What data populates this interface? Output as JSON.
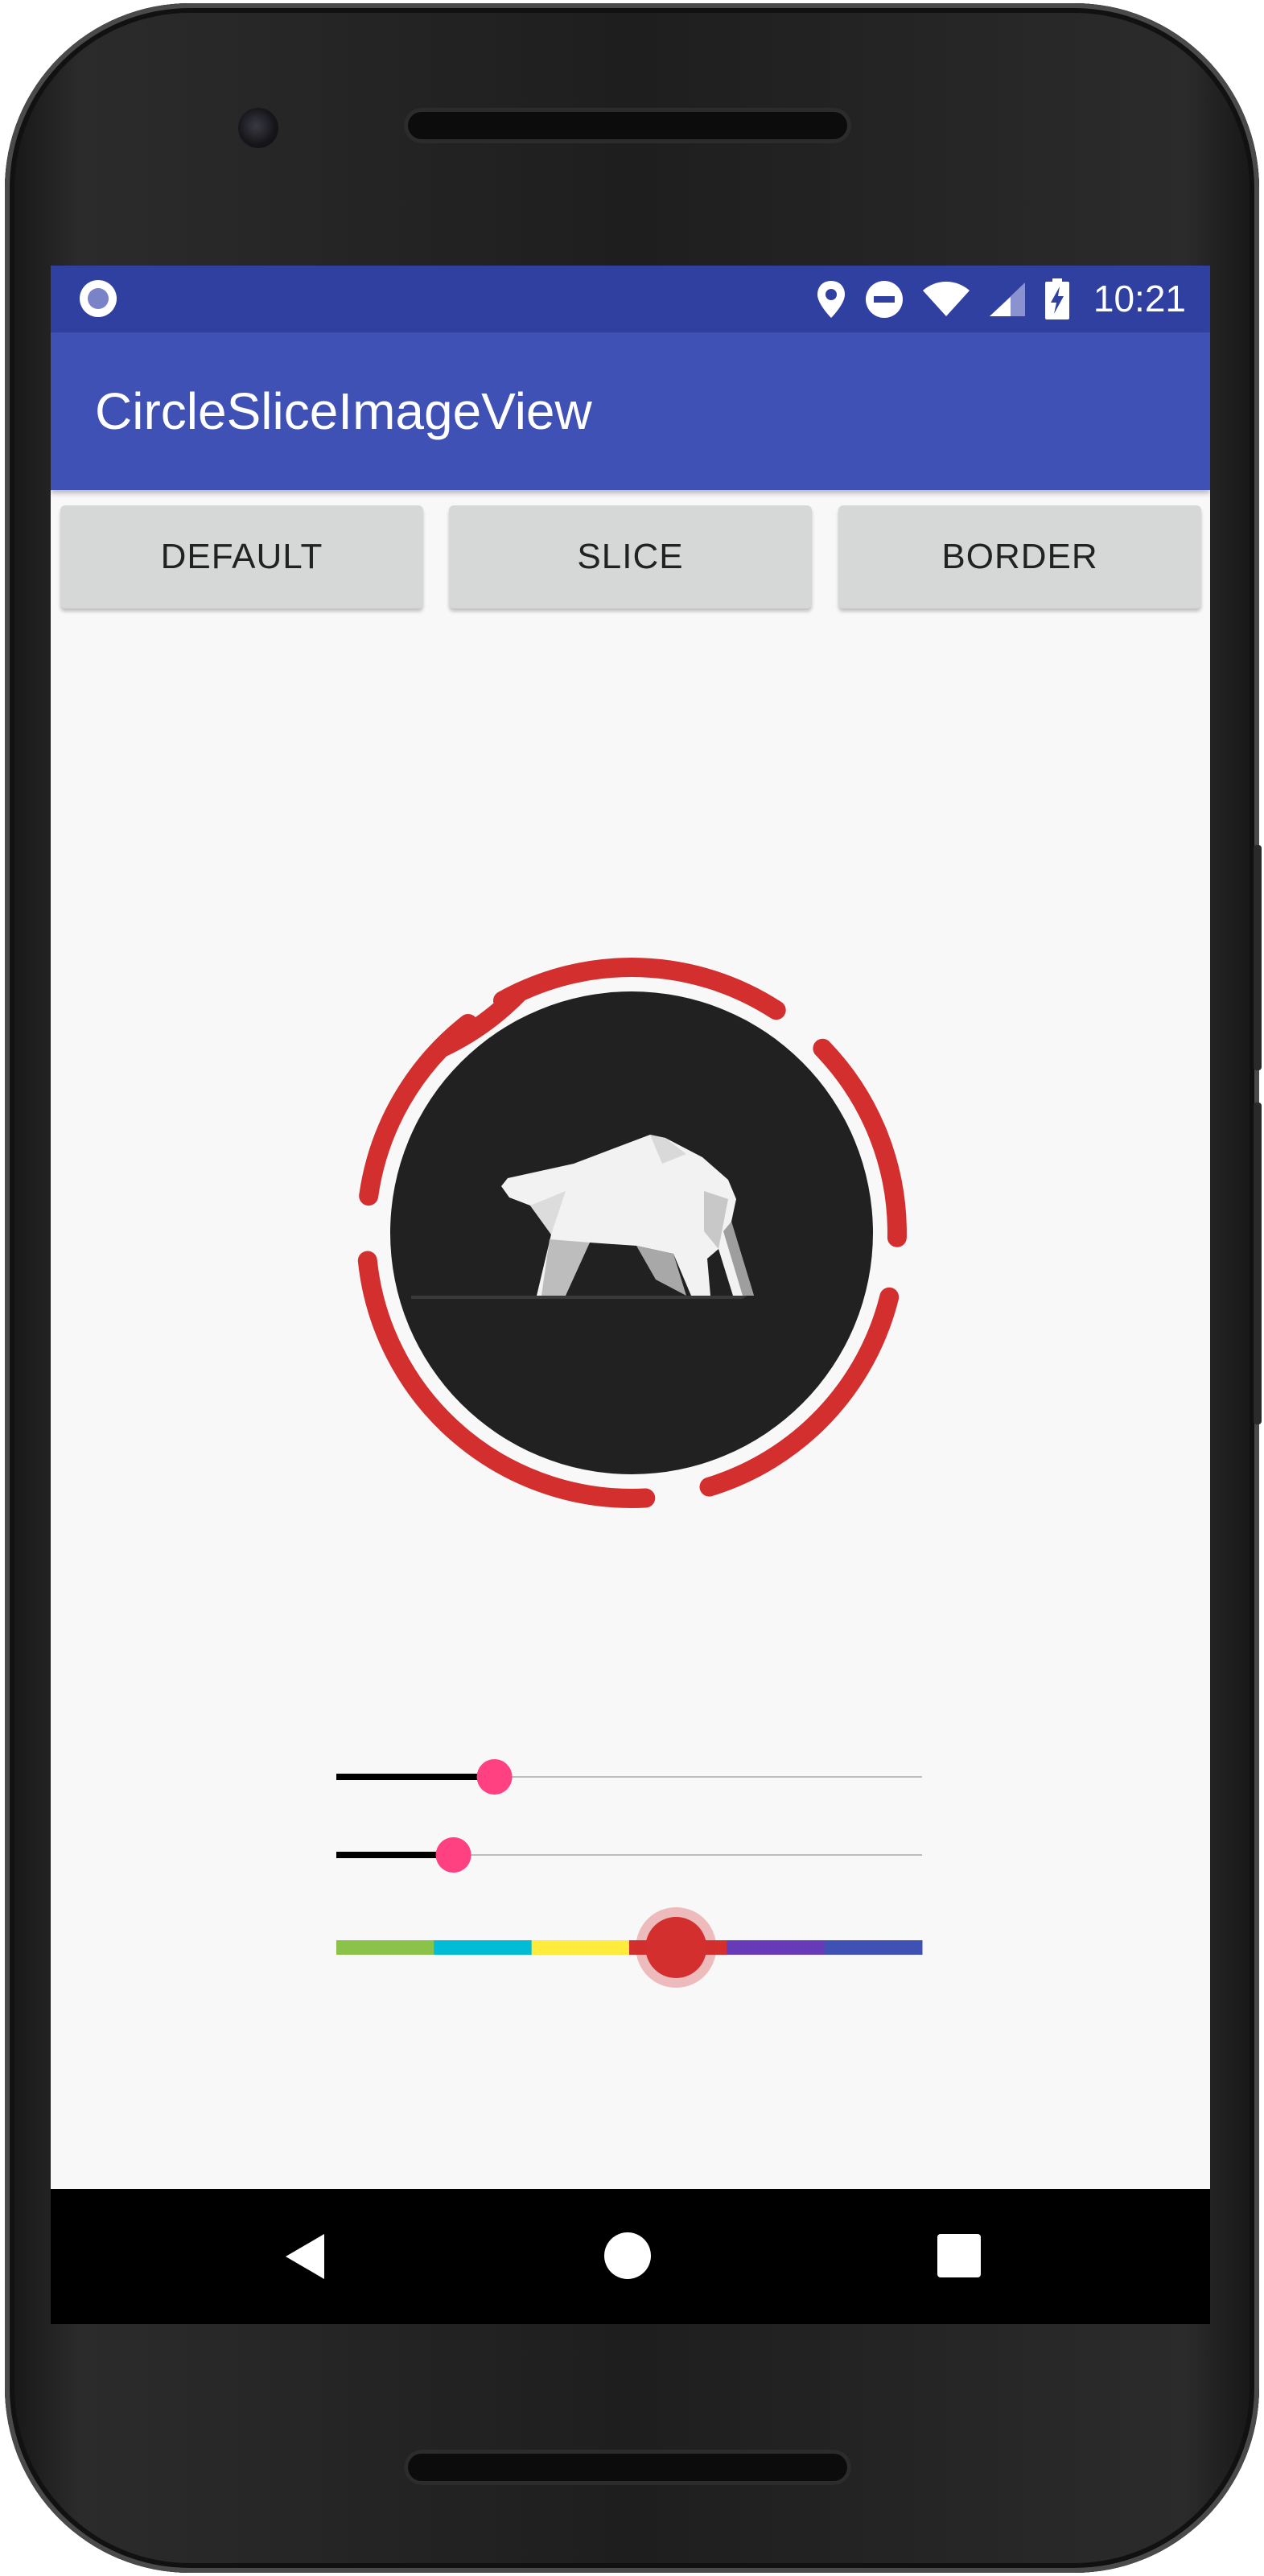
{
  "status_bar": {
    "time": "10:21",
    "left_icon": "record-dot-icon",
    "icons": [
      "location-pin-icon",
      "do-not-disturb-icon",
      "wifi-icon",
      "signal-icon",
      "battery-charging-icon"
    ]
  },
  "app_bar": {
    "title": "CircleSliceImageView"
  },
  "buttons": {
    "default_label": "DEFAULT",
    "slice_label": "SLICE",
    "border_label": "BORDER"
  },
  "circle_view": {
    "image": "polar-bear-logo",
    "slice_color": "#d32f2f",
    "center_color": "#212121"
  },
  "sliders": {
    "slice_count": {
      "value": 0.27,
      "active_color": "#000000",
      "thumb_color": "#ff4081"
    },
    "border_width": {
      "value": 0.2,
      "active_color": "#000000",
      "thumb_color": "#ff4081"
    },
    "color_picker": {
      "value": 0.58,
      "segments": [
        "#8bc34a",
        "#00bcd4",
        "#ffeb3b",
        "#d32f2f",
        "#673ab7",
        "#3f51b5"
      ],
      "thumb_color": "#d32f2f"
    }
  },
  "nav_bar": {
    "back": "back-icon",
    "home": "home-icon",
    "recent": "recents-icon"
  },
  "colors": {
    "primary": "#3f51b5",
    "primary_dark": "#3040a0",
    "accent": "#ff4081"
  }
}
